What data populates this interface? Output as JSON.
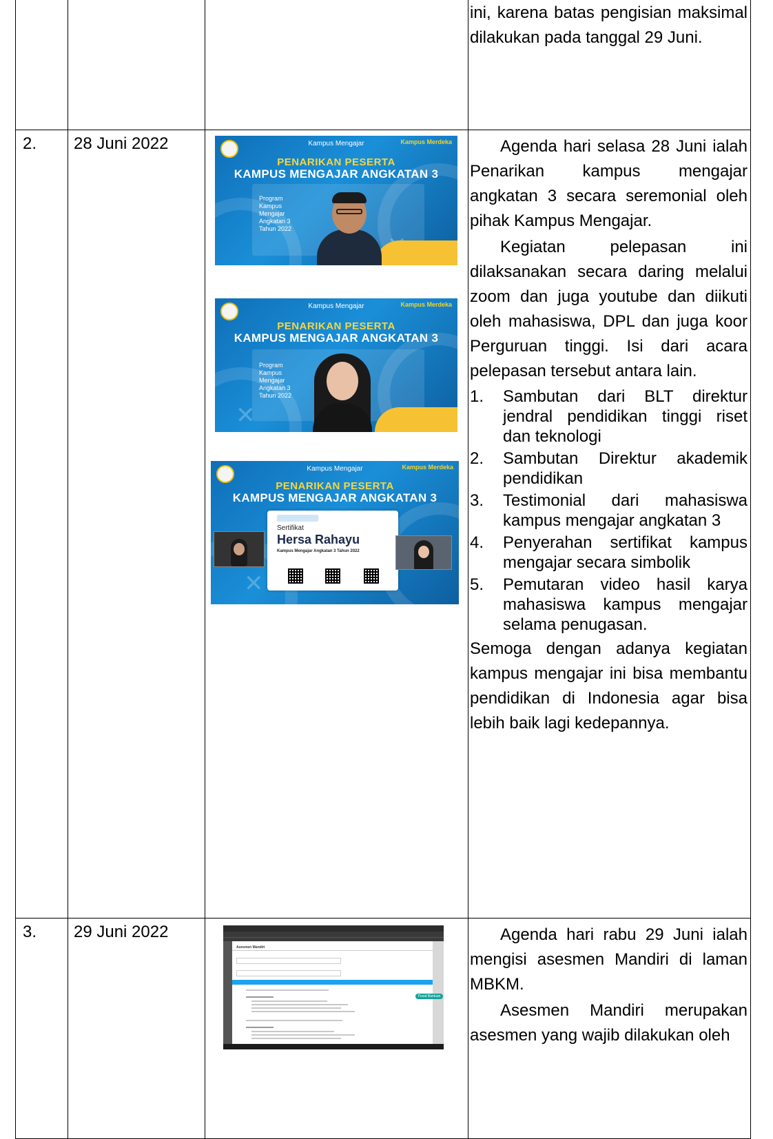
{
  "rows": [
    {
      "no": "",
      "date": "",
      "description": "ini, karena batas pengisian maksimal dilakukan pada tanggal 29 Juni."
    },
    {
      "no": "2.",
      "date": "28 Juni 2022",
      "photos": [
        {
          "header": "Kampus Mengajar",
          "title_line1": "PENARIKAN PESERTA",
          "title_line2": "KAMPUS MENGAJAR ANGKATAN 3",
          "badge": "Kampus Merdeka",
          "panel_text": "Program Kampus Mengajar Angkatan 3 Tahun 2022",
          "speaker": "male"
        },
        {
          "header": "Kampus Mengajar",
          "title_line1": "PENARIKAN PESERTA",
          "title_line2": "KAMPUS MENGAJAR ANGKATAN 3",
          "badge": "Kampus Merdeka",
          "panel_text": "Program Kampus Mengajar Angkatan 3 Tahun 2022",
          "speaker": "female"
        },
        {
          "header": "Kampus Mengajar",
          "title_line1": "PENARIKAN PESERTA",
          "title_line2": "KAMPUS MENGAJAR ANGKATAN 3",
          "badge": "Kampus Merdeka",
          "cert_label": "Sertifikat",
          "cert_name": "Hersa Rahayu",
          "cert_program": "Kampus Mengajar Angkatan 3 Tahun 2022"
        }
      ],
      "para1": "Agenda hari selasa 28 Juni ialah Penarikan kampus mengajar angkatan 3 secara seremonial oleh pihak Kampus Mengajar.",
      "para2": "Kegiatan pelepasan ini dilaksanakan secara daring melalui zoom dan juga youtube dan diikuti oleh mahasiswa, DPL dan juga koor Perguruan tinggi. Isi dari acara pelepasan tersebut antara lain.",
      "list": [
        {
          "n": "1.",
          "text": "Sambutan dari BLT direktur jendral pendidikan tinggi riset dan teknologi"
        },
        {
          "n": "2.",
          "text": "Sambutan Direktur akademik pendidikan"
        },
        {
          "n": "3.",
          "text": "Testimonial dari mahasiswa kampus mengajar angkatan 3"
        },
        {
          "n": "4.",
          "text": "Penyerahan sertifikat kampus mengajar secara simbolik"
        },
        {
          "n": "5.",
          "text": "Pemutaran video hasil karya mahasiswa kampus mengajar selama penugasan."
        }
      ],
      "closing": "Semoga dengan adanya kegiatan kampus mengajar ini bisa membantu pendidikan di Indonesia agar bisa lebih baik lagi kedepannya."
    },
    {
      "no": "3.",
      "date": "29 Juni 2022",
      "screenshot": {
        "modal_title": "Asesmen Mandiri",
        "button": "Pusat Bantuan"
      },
      "para1": "Agenda hari rabu 29 Juni ialah mengisi asesmen Mandiri di laman MBKM.",
      "para2": "Asesmen Mandiri merupakan asesmen yang wajib dilakukan oleh"
    }
  ],
  "colors": {
    "slide_blue": "#1a8fd8",
    "title_yellow": "#f6d640",
    "accent_teal": "#14a39a"
  }
}
